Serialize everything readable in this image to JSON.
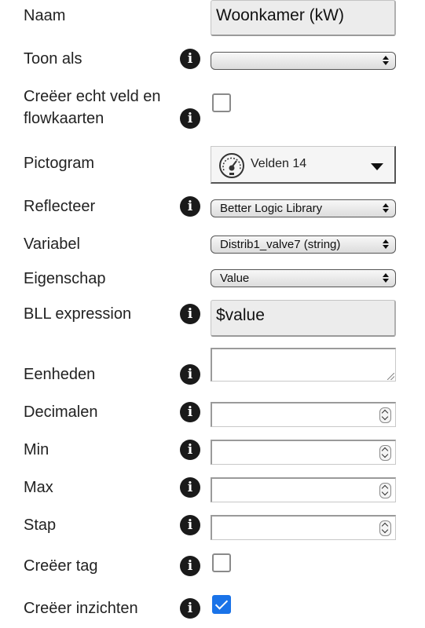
{
  "fields": {
    "naam": {
      "label": "Naam",
      "value": "Woonkamer (kW)"
    },
    "toon_als": {
      "label": "Toon als",
      "info_icon": "info-icon",
      "value": ""
    },
    "creeer_veld": {
      "label_line1": "Creëer echt veld en",
      "label_line2": "flowkaarten",
      "info_icon": "info-icon",
      "checked": false
    },
    "pictogram": {
      "label": "Pictogram",
      "value": "Velden 14",
      "icon": "gauge-icon"
    },
    "reflecteer": {
      "label": "Reflecteer",
      "info_icon": "info-icon",
      "value": "Better Logic Library"
    },
    "variabel": {
      "label": "Variabel",
      "value": "Distrib1_valve7 (string)"
    },
    "eigenschap": {
      "label": "Eigenschap",
      "value": "Value"
    },
    "bll_expression": {
      "label": "BLL expression",
      "info_icon": "info-icon",
      "value": "$value"
    },
    "eenheden": {
      "label": "Eenheden",
      "info_icon": "info-icon",
      "value": ""
    },
    "decimalen": {
      "label": "Decimalen",
      "info_icon": "info-icon",
      "value": ""
    },
    "min": {
      "label": "Min",
      "info_icon": "info-icon",
      "value": ""
    },
    "max": {
      "label": "Max",
      "info_icon": "info-icon",
      "value": ""
    },
    "stap": {
      "label": "Stap",
      "info_icon": "info-icon",
      "value": ""
    },
    "creeer_tag": {
      "label": "Creëer tag",
      "info_icon": "info-icon",
      "checked": false
    },
    "creeer_inzichten": {
      "label": "Creëer inzichten",
      "info_icon": "info-icon",
      "checked": true
    }
  },
  "info_glyph": "i",
  "colors": {
    "checkbox_checked": "#1a73e8",
    "info_icon_bg": "#1a1a1a",
    "textbox_bg": "#ececec"
  }
}
